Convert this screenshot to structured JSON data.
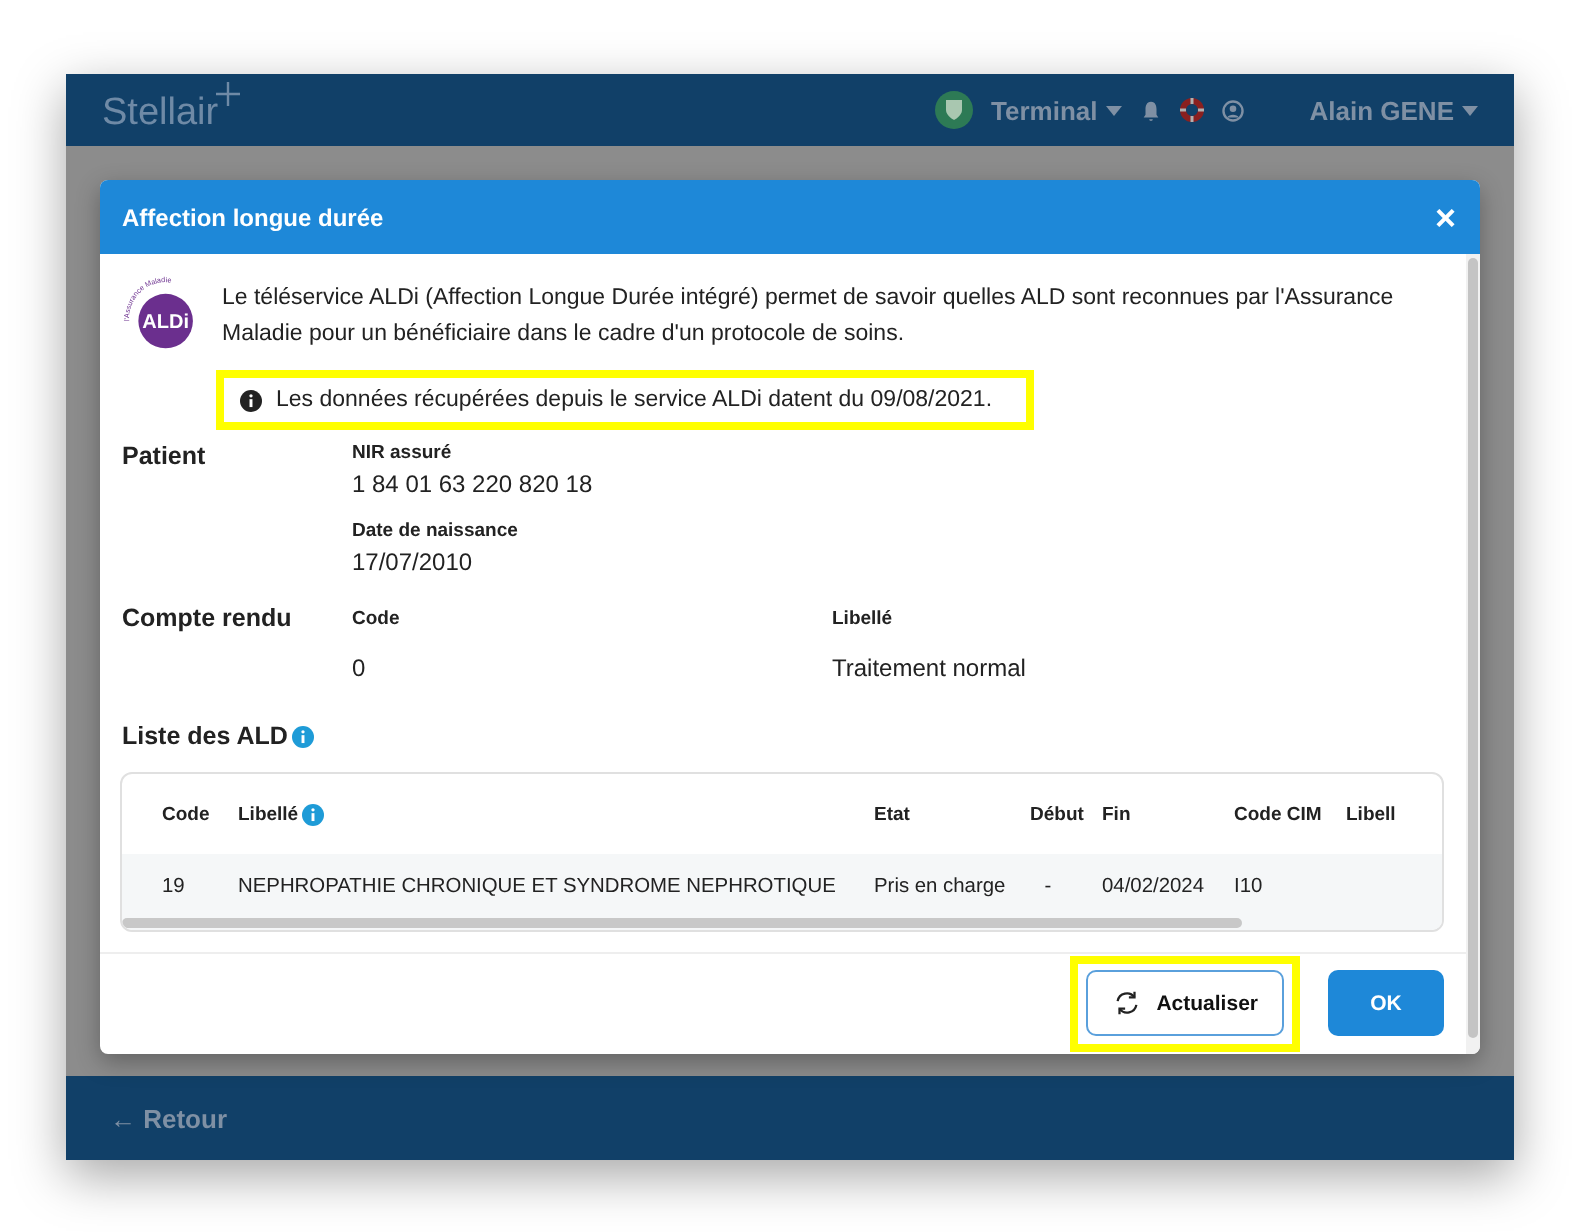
{
  "app": {
    "logo": "Stellair",
    "terminal": "Terminal",
    "user": "Alain GENE",
    "back": "← Retour"
  },
  "modal": {
    "title": "Affection longue durée",
    "close": "×",
    "logo": {
      "text": "ALDi",
      "caption": "l'Assurance Maladie"
    },
    "description": "Le téléservice ALDi (Affection Longue Durée intégré) permet de savoir quelles ALD sont reconnues par l'Assurance Maladie pour un bénéficiaire dans le cadre d'un protocole de soins.",
    "notice": {
      "text": "Les données récupérées depuis le service ALDi datent du 09/08/2021.",
      "highlighted": true
    },
    "patient": {
      "heading": "Patient",
      "fields": [
        {
          "label": "NIR assuré",
          "value": "1 84 01 63 220 820 18"
        },
        {
          "label": "Date de naissance",
          "value": "17/07/2010"
        }
      ]
    },
    "report": {
      "heading": "Compte rendu",
      "columns": [
        "Code",
        "Libellé"
      ],
      "values": [
        "0",
        "Traitement normal"
      ]
    },
    "ald_list": {
      "heading": "Liste des ALD",
      "columns": [
        {
          "label": "Code",
          "info": false
        },
        {
          "label": "Libellé",
          "info": true
        },
        {
          "label": "Etat",
          "info": false
        },
        {
          "label": "Début",
          "info": false
        },
        {
          "label": "Fin",
          "info": false
        },
        {
          "label": "Code CIM",
          "info": false
        },
        {
          "label": "Libell",
          "info": false
        }
      ],
      "rows": [
        [
          "19",
          "NEPHROPATHIE CHRONIQUE ET SYNDROME NEPHROTIQUE",
          "Pris en charge",
          "-",
          "04/02/2024",
          "I10",
          ""
        ]
      ]
    },
    "buttons": [
      {
        "label": "Actualiser",
        "kind": "refresh",
        "highlighted": true
      },
      {
        "label": "OK",
        "kind": "primary",
        "highlighted": false
      }
    ]
  }
}
